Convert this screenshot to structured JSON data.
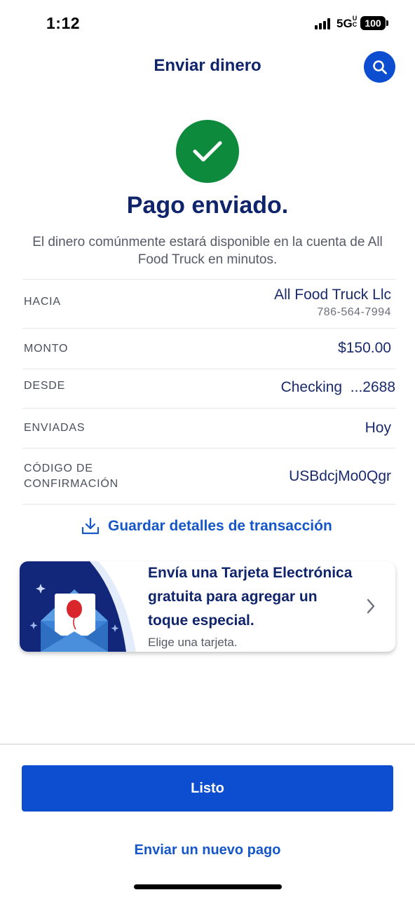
{
  "status_bar": {
    "time": "1:12",
    "network": "5G",
    "network_suffix": "UC",
    "battery": "100"
  },
  "header": {
    "title": "Enviar dinero",
    "search_icon": "search-icon"
  },
  "success": {
    "icon": "checkmark-icon",
    "title": "Pago enviado.",
    "subtitle": "El dinero comúnmente estará disponible en la cuenta de All Food Truck en minutos."
  },
  "details": {
    "to_label": "HACIA",
    "to_name": "All Food Truck Llc",
    "to_phone": "786-564-7994",
    "amount_label": "MONTO",
    "amount_value": "$150.00",
    "from_label": "DESDE",
    "from_value": "Checking  ...2688",
    "sent_label": "ENVIADAS",
    "sent_value": "Hoy",
    "confirm_label_1": "CÓDIGO DE",
    "confirm_label_2": "CONFIRMACIÓN",
    "confirm_value": "USBdcjMo0Qgr"
  },
  "save_details": {
    "icon": "download-icon",
    "label": "Guardar detalles de transacción"
  },
  "promo": {
    "title": "Envía una Tarjeta Electrónica gratuita para agregar un toque especial.",
    "subtitle": "Elige una tarjeta.",
    "icon": "envelope-balloon-illustration"
  },
  "actions": {
    "done_label": "Listo",
    "new_payment_label": "Enviar un nuevo pago"
  },
  "colors": {
    "primary": "#0c4ecf",
    "navy": "#10246b",
    "success": "#0e8a3c"
  }
}
